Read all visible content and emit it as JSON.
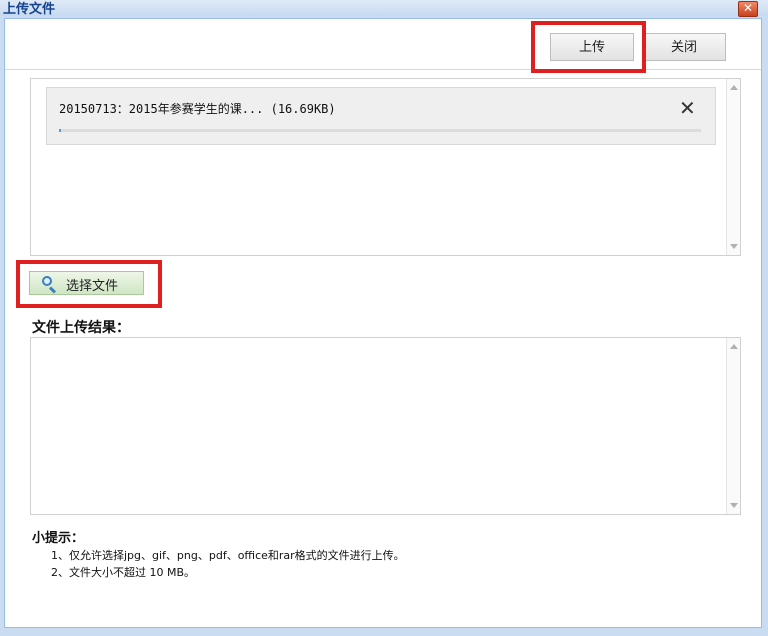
{
  "window": {
    "title": "上传文件"
  },
  "toolbar": {
    "upload_label": "上传",
    "close_label": "关闭"
  },
  "queue": {
    "items": [
      {
        "name": "20150713：2015年参赛学生的课... (16.69KB)",
        "progress": 0.0
      }
    ]
  },
  "select_button": {
    "label": "选择文件"
  },
  "results": {
    "title": "文件上传结果："
  },
  "tips": {
    "title": "小提示：",
    "line1": "1、仅允许选择jpg、gif、png、pdf、office和rar格式的文件进行上传。",
    "line2": "2、文件大小不超过 10 MB。"
  },
  "colors": {
    "highlight": "#e02020",
    "title_text": "#15428b"
  }
}
